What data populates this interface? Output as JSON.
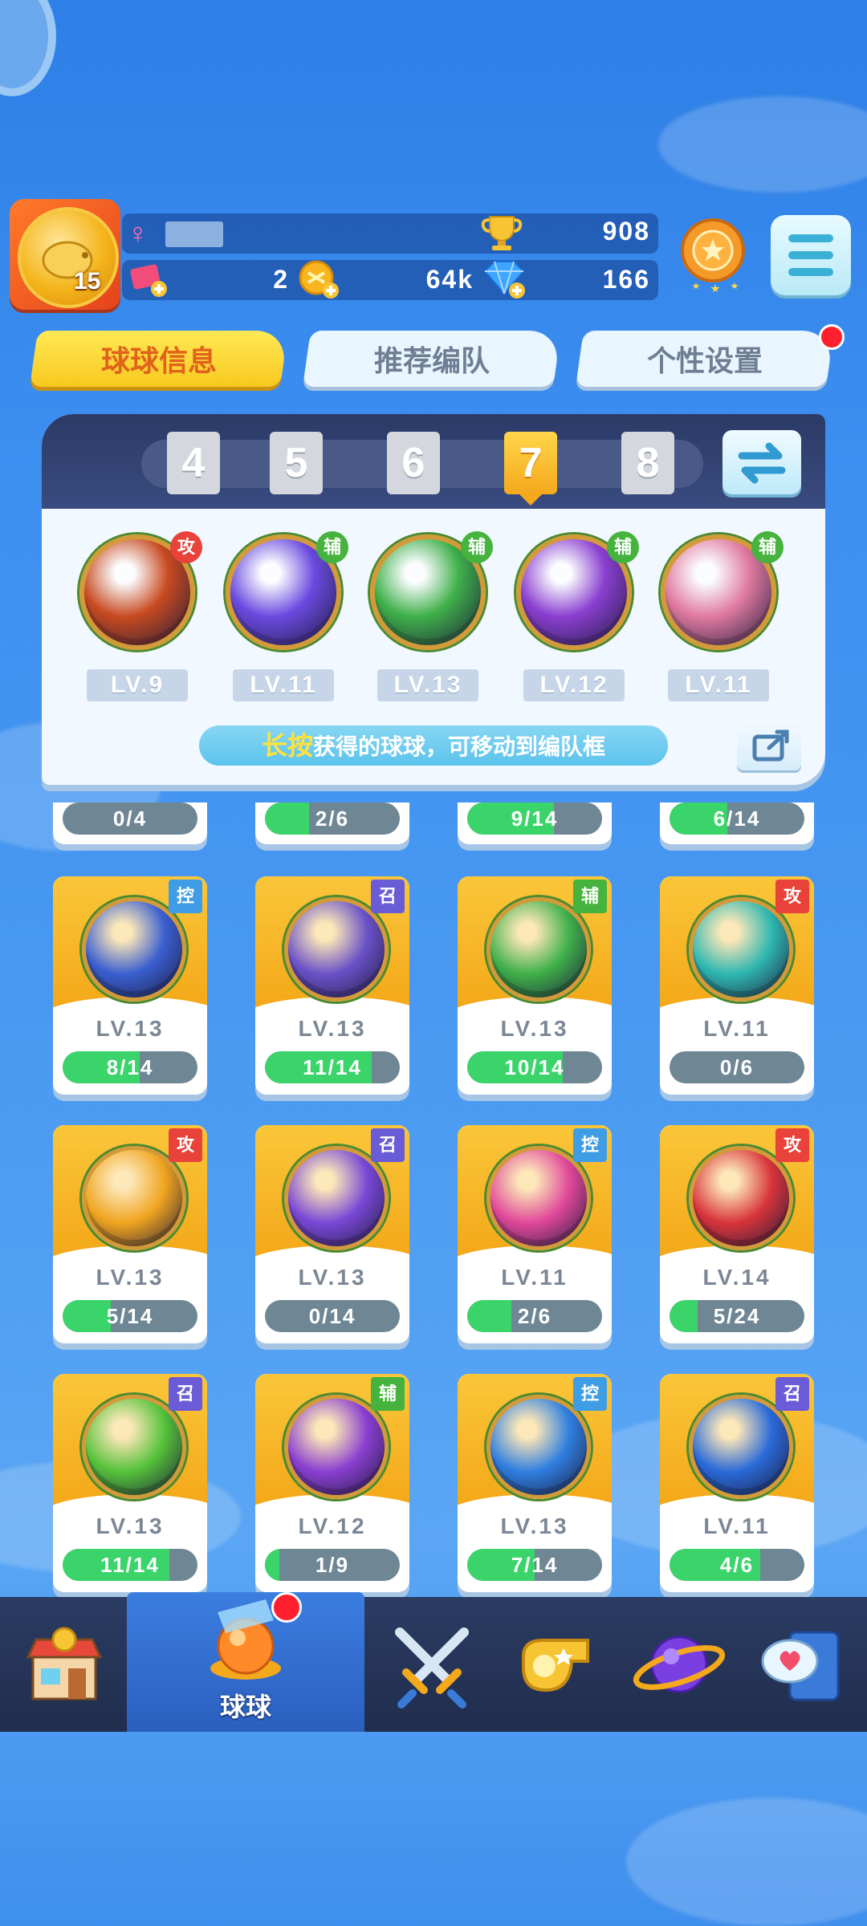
{
  "header": {
    "player_level": "15",
    "trophies": "908",
    "tickets": "2",
    "coins": "64k",
    "gems": "166"
  },
  "tabs": [
    {
      "label": "球球信息",
      "active": true
    },
    {
      "label": "推荐编队",
      "active": false
    },
    {
      "label": "个性设置",
      "active": false,
      "has_notification": true
    }
  ],
  "team": {
    "numbers": [
      "4",
      "5",
      "6",
      "7",
      "8"
    ],
    "selected": "7",
    "slots": [
      {
        "level": "LV.9",
        "tag": "攻",
        "icon": "infinity-icon",
        "color": "#c84a20"
      },
      {
        "level": "LV.11",
        "tag": "辅",
        "icon": "lightning-icon",
        "color": "#6a4ae0"
      },
      {
        "level": "LV.13",
        "tag": "辅",
        "icon": "arrow-up-icon",
        "color": "#3fb04a"
      },
      {
        "level": "LV.12",
        "tag": "辅",
        "icon": "leaf-icon",
        "color": "#8a3fd0"
      },
      {
        "level": "LV.11",
        "tag": "辅",
        "icon": "people-icon",
        "color": "#e07aa0"
      }
    ],
    "hint_key": "长按",
    "hint_text": "获得的球球，可移动到编队框"
  },
  "partial_row": [
    {
      "progress": "0/4",
      "fill": 0
    },
    {
      "progress": "2/6",
      "fill": 0.33
    },
    {
      "progress": "9/14",
      "fill": 0.64
    },
    {
      "progress": "6/14",
      "fill": 0.43
    }
  ],
  "balls": [
    {
      "level": "LV.13",
      "progress": "8/14",
      "fill": 0.57,
      "tag": "控",
      "tag_type": "ctrl",
      "icon": "clock-icon",
      "color": "#3a5fd0"
    },
    {
      "level": "LV.13",
      "progress": "11/14",
      "fill": 0.79,
      "tag": "召",
      "tag_type": "sum",
      "icon": "ghost-icon",
      "color": "#6a52c8"
    },
    {
      "level": "LV.13",
      "progress": "10/14",
      "fill": 0.71,
      "tag": "辅",
      "tag_type": "sup",
      "icon": "arrow-up-icon",
      "color": "#3fb04a"
    },
    {
      "level": "LV.11",
      "progress": "0/6",
      "fill": 0,
      "tag": "攻",
      "tag_type": "atk",
      "icon": "tornado-icon",
      "color": "#2fb7b0"
    },
    {
      "level": "LV.13",
      "progress": "5/14",
      "fill": 0.36,
      "tag": "攻",
      "tag_type": "atk",
      "icon": "shuriken-icon",
      "color": "#f0a41f"
    },
    {
      "level": "LV.13",
      "progress": "0/14",
      "fill": 0,
      "tag": "召",
      "tag_type": "sum",
      "icon": "orb-icon",
      "color": "#7a48d6"
    },
    {
      "level": "LV.11",
      "progress": "2/6",
      "fill": 0.33,
      "tag": "控",
      "tag_type": "ctrl",
      "icon": "blade-icon",
      "color": "#e0489a"
    },
    {
      "level": "LV.14",
      "progress": "5/24",
      "fill": 0.21,
      "tag": "攻",
      "tag_type": "atk",
      "icon": "fist-icon",
      "color": "#d8343a"
    },
    {
      "level": "LV.13",
      "progress": "11/14",
      "fill": 0.79,
      "tag": "召",
      "tag_type": "sum",
      "icon": "star-gear-icon",
      "color": "#55c23a"
    },
    {
      "level": "LV.12",
      "progress": "1/9",
      "fill": 0.11,
      "tag": "辅",
      "tag_type": "sup",
      "icon": "leaf-icon",
      "color": "#8a3fd0"
    },
    {
      "level": "LV.13",
      "progress": "7/14",
      "fill": 0.5,
      "tag": "控",
      "tag_type": "ctrl",
      "icon": "snowflake-icon",
      "color": "#2f7fe0"
    },
    {
      "level": "LV.11",
      "progress": "4/6",
      "fill": 0.67,
      "tag": "召",
      "tag_type": "sum",
      "icon": "castle-icon",
      "color": "#2a6ad8"
    }
  ],
  "nav": {
    "active_label": "球球",
    "items": [
      "shop-icon",
      "balls-icon",
      "battle-swords-icon",
      "whistle-icon",
      "planet-icon",
      "chat-heart-icon"
    ]
  }
}
